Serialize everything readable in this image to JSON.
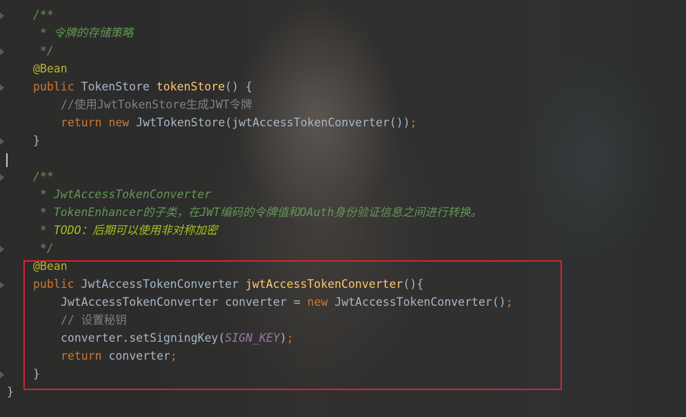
{
  "editor": {
    "lines": {
      "l1": {
        "a": "/**"
      },
      "l2": {
        "a": " * 令牌的存储策略"
      },
      "l3": {
        "a": " */"
      },
      "l4": {
        "a": "@Bean"
      },
      "l5": {
        "a": "public",
        "b": " TokenStore ",
        "c": "tokenStore",
        "d": "() {"
      },
      "l6": {
        "a": "//使用JwtTokenStore生成JWT令牌"
      },
      "l7": {
        "a": "return",
        "b": " ",
        "c": "new",
        "d": " JwtTokenStore(jwtAccessTokenConverter())",
        "e": ";"
      },
      "l8": {
        "a": "}"
      },
      "l10": {
        "a": "/**"
      },
      "l11": {
        "a": " * JwtAccessTokenConverter"
      },
      "l12": {
        "a": " * TokenEnhancer的子类，在JWT编码的令牌值和OAuth身份验证信息之间进行转换。"
      },
      "l13": {
        "a": " * ",
        "b": "TODO：后期可以使用非对称加密"
      },
      "l14": {
        "a": " */"
      },
      "l15": {
        "a": "@Bean"
      },
      "l16": {
        "a": "public",
        "b": " JwtAccessTokenConverter ",
        "c": "jwtAccessTokenConverter",
        "d": "(){"
      },
      "l17": {
        "a": "JwtAccessTokenConverter converter = ",
        "b": "new",
        "c": " JwtAccessTokenConverter()",
        "d": ";"
      },
      "l18": {
        "a": "// 设置秘钥"
      },
      "l19": {
        "a": "converter.setSigningKey(",
        "b": "SIGN_KEY",
        "c": ")",
        "d": ";"
      },
      "l20": {
        "a": "return",
        "b": " converter",
        "c": ";"
      },
      "l21": {
        "a": "}"
      },
      "l22": {
        "a": "}"
      }
    },
    "colors": {
      "background": "#2b2b2b",
      "keyword": "#cc7832",
      "annotation": "#bbb529",
      "method_declaration": "#ffc66d",
      "line_comment": "#808080",
      "doc_comment": "#629755",
      "todo": "#a8c023",
      "constant": "#9876aa",
      "text": "#a9b7c6",
      "highlight_box": "#e0202e"
    }
  }
}
